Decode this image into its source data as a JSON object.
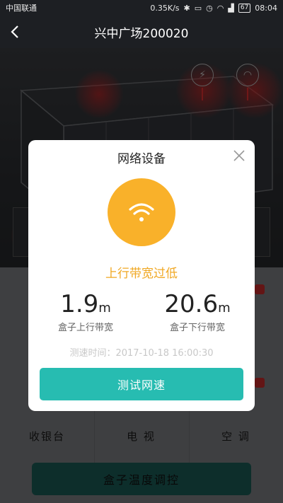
{
  "status_bar": {
    "carrier": "中国联通",
    "speed": "0.35K/s",
    "battery": "67",
    "time": "08:04"
  },
  "header": {
    "title": "兴中广场200020"
  },
  "grid": {
    "items": [
      {
        "label": "收银台"
      },
      {
        "label": "电 视"
      },
      {
        "label": "空 调"
      }
    ],
    "bottom_button": "盒子温度调控"
  },
  "dialog": {
    "title": "网络设备",
    "status": "上行带宽过低",
    "upload": {
      "value": "1.9",
      "unit": "m",
      "label": "盒子上行带宽"
    },
    "download": {
      "value": "20.6",
      "unit": "m",
      "label": "盒子下行带宽"
    },
    "test_time": "测速时间：2017-10-18   16:00:30",
    "test_button": "测试网速"
  },
  "colors": {
    "accent": "#27bcb1",
    "warning": "#f0a824",
    "wifi_circle": "#f9b12a"
  }
}
